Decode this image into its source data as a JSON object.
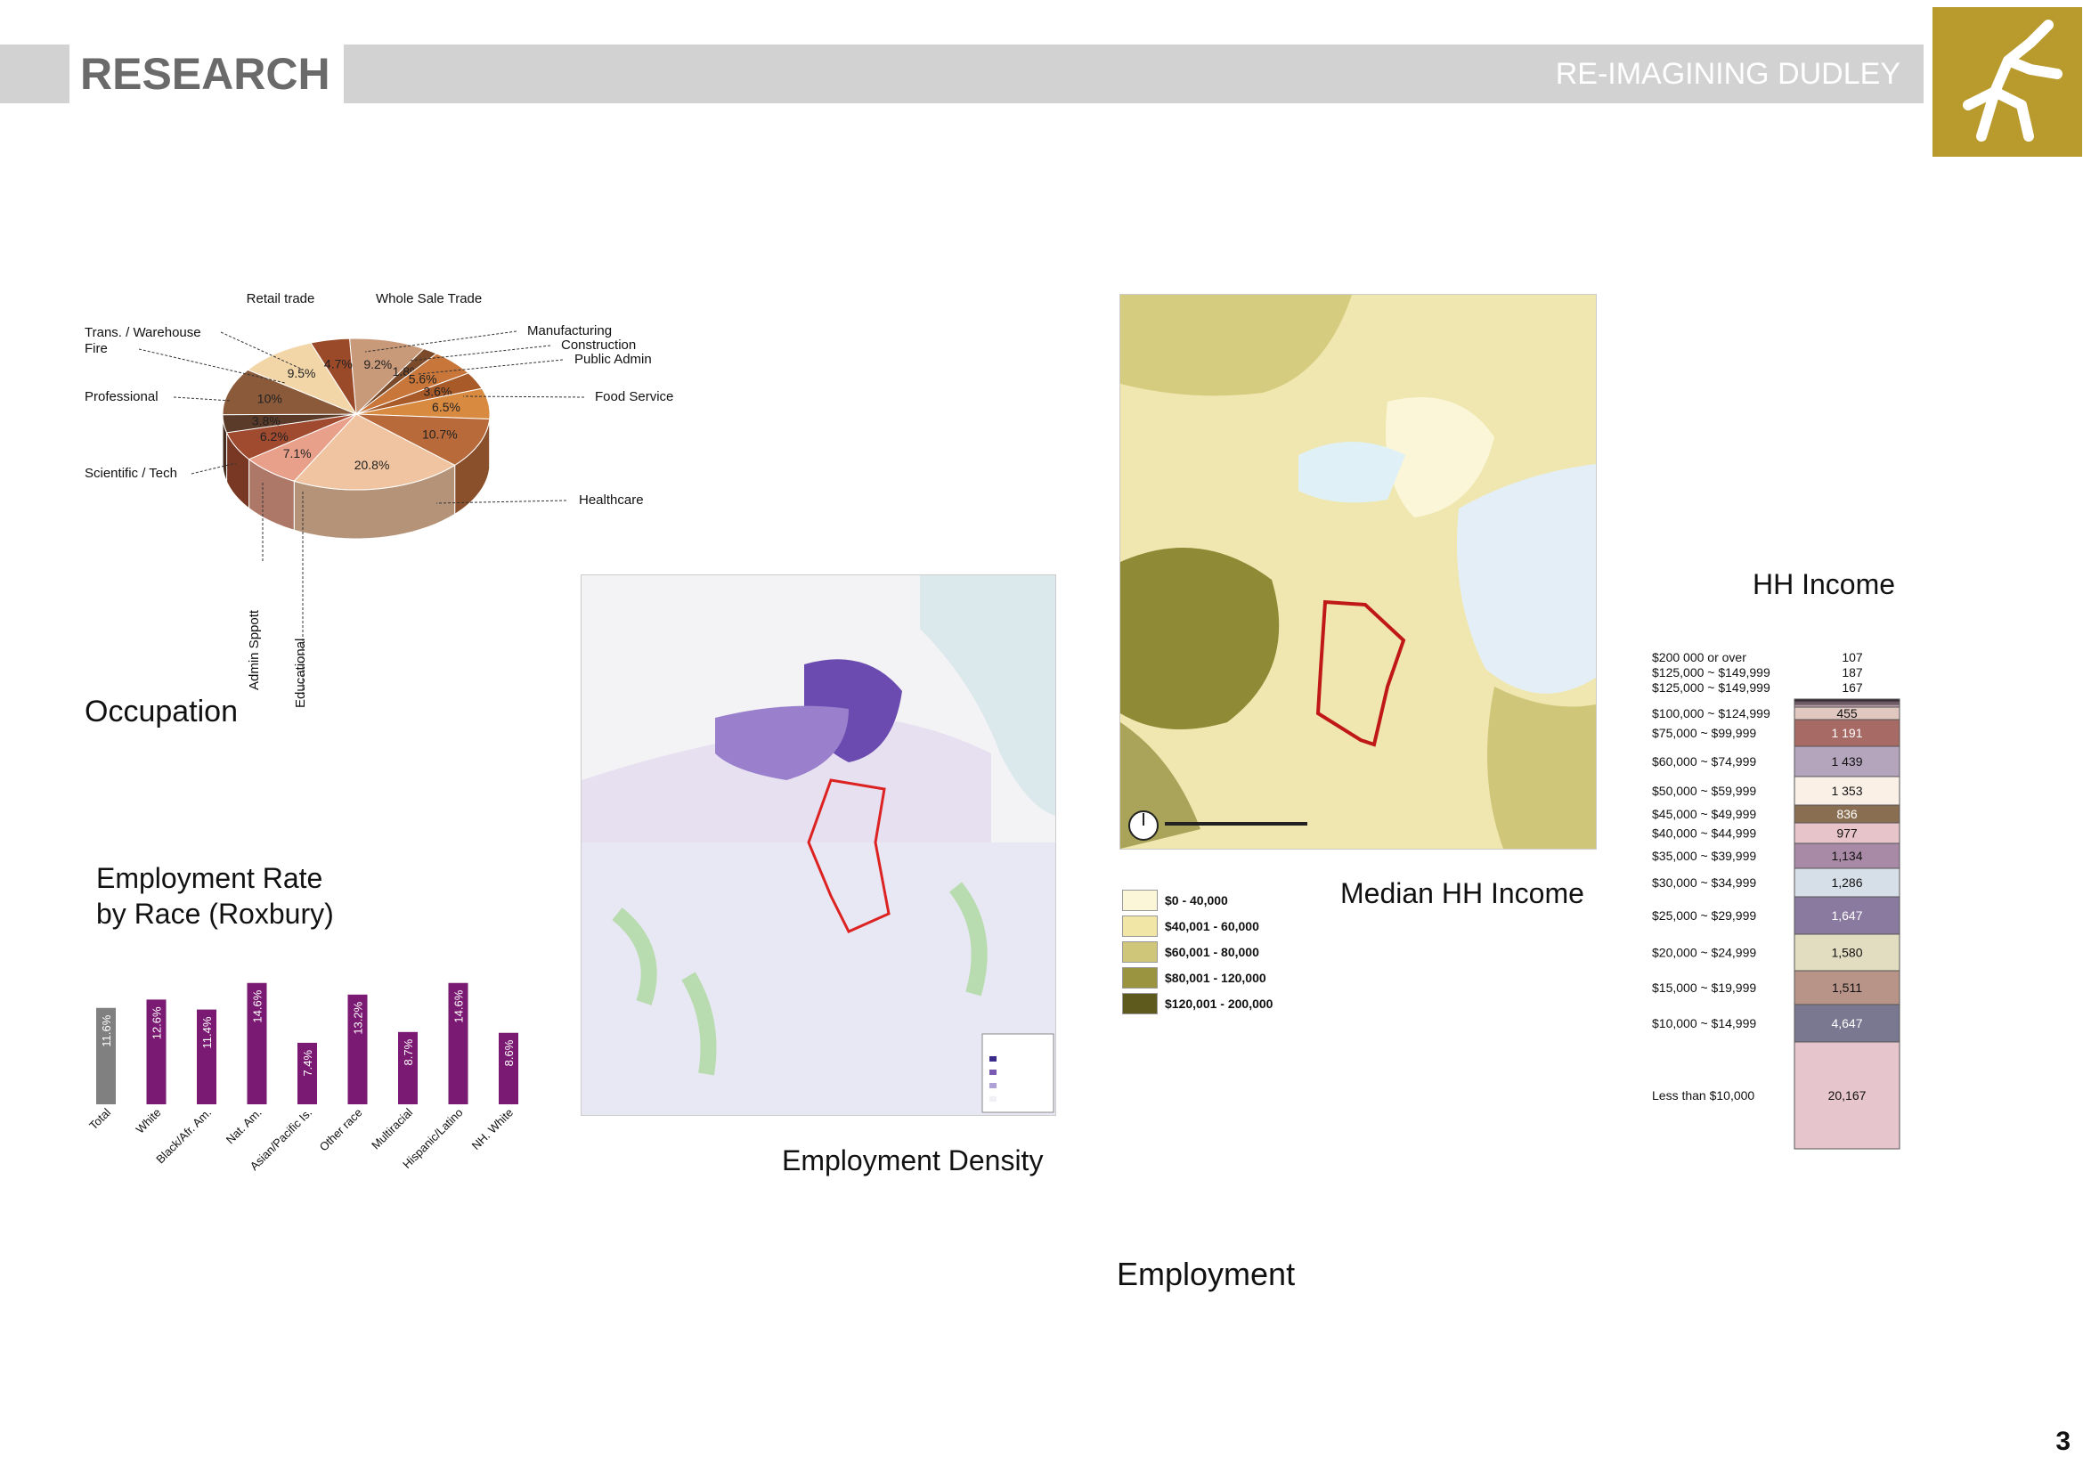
{
  "header": {
    "title": "RESEARCH",
    "subtitle": "RE-IMAGINING DUDLEY"
  },
  "occupation": {
    "title": "Occupation",
    "chart_data": {
      "type": "pie",
      "slices": [
        {
          "label": "Retail trade",
          "value": 9.2,
          "value_label": "9.2%",
          "color": "#c99a7a"
        },
        {
          "label": "Whole Sale Trade",
          "value": 1.8,
          "value_label": "1.8%",
          "color": "#7a4a2a"
        },
        {
          "label": "Manufacturing",
          "value": 5.6,
          "value_label": "5.6%",
          "color": "#c8763a"
        },
        {
          "label": "Construction",
          "value": 3.6,
          "value_label": "3.6%",
          "color": "#a85a28"
        },
        {
          "label": "Public Admin",
          "value": 6.5,
          "value_label": "6.5%",
          "color": "#d88a40"
        },
        {
          "label": "Food Service",
          "value": 10.7,
          "value_label": "10.7%",
          "color": "#b86a3a"
        },
        {
          "label": "Healthcare",
          "value": 20.8,
          "value_label": "20.8%",
          "color": "#f0c4a0"
        },
        {
          "label": "Educational",
          "value": 7.1,
          "value_label": "7.1%",
          "color": "#e8a08a"
        },
        {
          "label": "Admin Sppott",
          "value": 6.2,
          "value_label": "6.2%",
          "color": "#a04a30"
        },
        {
          "label": "Scientific / Tech",
          "value": 3.8,
          "value_label": "3.8%",
          "color": "#5a3a28"
        },
        {
          "label": "Professional",
          "value": 10,
          "value_label": "10%",
          "color": "#8a5a3a"
        },
        {
          "label": "Fire",
          "value": 9.5,
          "value_label": "9.5%",
          "color": "#f3d6a8"
        },
        {
          "label": "Trans. / Warehouse",
          "value": 4.7,
          "value_label": "4.7%",
          "color": "#9a4a28"
        }
      ]
    },
    "callouts": {
      "retail": "Retail trade",
      "wholesale": "Whole Sale Trade",
      "trans": "Trans. / Warehouse",
      "fire": "Fire",
      "professional": "Professional",
      "scitech": "Scientific / Tech",
      "manufacturing": "Manufacturing",
      "construction": "Construction",
      "publicadmin": "Public Admin",
      "food": "Food Service",
      "healthcare": "Healthcare",
      "admin": "Admin Sppott",
      "educational": "Educational"
    }
  },
  "employment_rate": {
    "title_line1": "Employment Rate",
    "title_line2": "by Race (Roxbury)",
    "chart_data": {
      "type": "bar",
      "categories": [
        "Total",
        "White",
        "Black/Afr. Am.",
        "Nat. Am.",
        "Asian/Pacific Is.",
        "Other race",
        "Multiracial",
        "Hispanic/Latino",
        "NH. White"
      ],
      "values": [
        11.6,
        12.6,
        11.4,
        14.6,
        7.4,
        13.2,
        8.7,
        14.6,
        8.6
      ],
      "value_labels": [
        "11.6%",
        "12.6%",
        "11.4%",
        "14.6%",
        "7.4%",
        "13.2%",
        "8.7%",
        "14.6%",
        "8.6%"
      ],
      "colors": [
        "#808080",
        "#7a1a72",
        "#7a1a72",
        "#7a1a72",
        "#7a1a72",
        "#7a1a72",
        "#7a1a72",
        "#7a1a72",
        "#7a1a72"
      ]
    }
  },
  "employment_density": {
    "title": "Employment Density"
  },
  "median_income": {
    "title": "Median HH Income",
    "legend": [
      {
        "label": "$0 - 40,000",
        "color": "#fbf6d8"
      },
      {
        "label": "$40,001 - 60,000",
        "color": "#f2e6a6"
      },
      {
        "label": "$60,001 - 80,000",
        "color": "#cfc67a"
      },
      {
        "label": "$80,001 - 120,000",
        "color": "#9a9440"
      },
      {
        "label": "$120,001 - 200,000",
        "color": "#5e5a1e"
      }
    ]
  },
  "hh_income": {
    "title": "HH Income",
    "chart_data": {
      "type": "bar",
      "rows": [
        {
          "label": "$200 000 or over",
          "value": 107,
          "value_label": "107",
          "color": "#3a2a3a"
        },
        {
          "label": "$125,000 ~ $149,999",
          "value": 187,
          "value_label": "187",
          "color": "#7a5a6a"
        },
        {
          "label": "$125,000 ~ $149,999",
          "value": 167,
          "value_label": "167",
          "color": "#b89aa8"
        },
        {
          "label": "$100,000 ~ $124,999",
          "value": 455,
          "value_label": "455",
          "color": "#e0c8c0"
        },
        {
          "label": "$75,000 ~ $99,999",
          "value": 1191,
          "value_label": "1 191",
          "color": "#a86a64"
        },
        {
          "label": "$60,000 ~ $74,999",
          "value": 1439,
          "value_label": "1 439",
          "color": "#b4a4bc"
        },
        {
          "label": "$50,000 ~ $59,999",
          "value": 1353,
          "value_label": "1 353",
          "color": "#fbf0e6"
        },
        {
          "label": "$45,000 ~ $49,999",
          "value": 836,
          "value_label": "836",
          "color": "#8a6e52"
        },
        {
          "label": "$40,000 ~ $44,999",
          "value": 977,
          "value_label": "977",
          "color": "#e6c4ca"
        },
        {
          "label": "$35,000 ~ $39,999",
          "value": 1134,
          "value_label": "1,134",
          "color": "#a88aa6"
        },
        {
          "label": "$30,000 ~ $34,999",
          "value": 1286,
          "value_label": "1,286",
          "color": "#d6dfe8"
        },
        {
          "label": "$25,000 ~ $29,999",
          "value": 1647,
          "value_label": "1,647",
          "color": "#8a7aa0"
        },
        {
          "label": "$20,000 ~ $24,999",
          "value": 1580,
          "value_label": "1,580",
          "color": "#e2dcc0"
        },
        {
          "label": "$15,000 ~ $19,999",
          "value": 1511,
          "value_label": "1,511",
          "color": "#b89488"
        },
        {
          "label": "$10,000 ~ $14,999",
          "value": 4647,
          "value_label": "4,647",
          "color": "#7a7890"
        },
        {
          "label": "Less than $10,000",
          "value": 20167,
          "value_label": "20,167",
          "color": "#e6c6cc"
        }
      ]
    }
  },
  "employment": {
    "title": "Employment"
  },
  "page_number": "3"
}
